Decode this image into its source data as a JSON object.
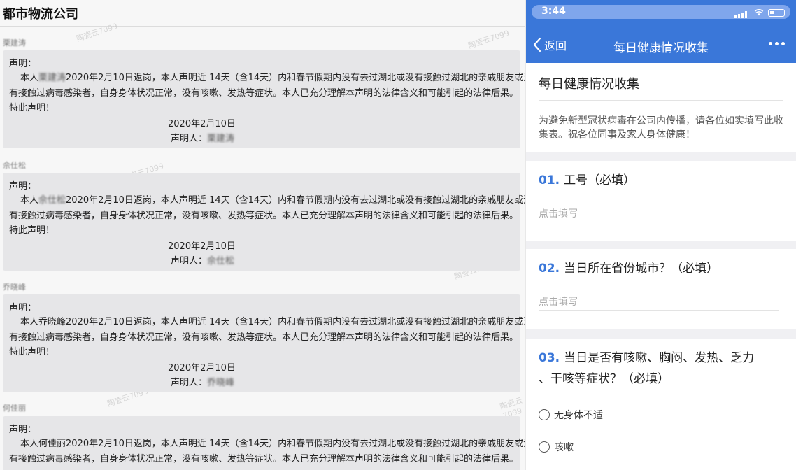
{
  "left": {
    "app_title": "都市物流公司",
    "declarations": [
      {
        "name": "栗建涛",
        "head": "声明：",
        "text_pre": "本人",
        "text_name": "栗建涛",
        "text_after": "2020年2月10日返岗，本人声明近 14天（含14天）内和春节假期内没有去过湖北或没有接触过湖北的亲戚朋友或没",
        "text_line2": "有接触过病毒感染者，自身身体状况正常，没有咳嗽、发热等症状。本人已充分理解本声明的法律含义和可能引起的法律后果。",
        "text_line3": "特此声明！",
        "date": "2020年2月10日",
        "sign_label": "声明人：",
        "sign_name": "栗建涛"
      },
      {
        "name": "佘仕松",
        "head": "声明：",
        "text_pre": "本人",
        "text_name": "佘仕松",
        "text_after": "2020年2月10日返岗，本人声明近 14天（含14天）内和春节假期内没有去过湖北或没有接触过湖北的亲戚朋友或没",
        "text_line2": "有接触过病毒感染者，自身身体状况正常，没有咳嗽、发热等症状。本人已充分理解本声明的法律含义和可能引起的法律后果。",
        "text_line3": "特此声明！",
        "date": "2020年2月10日",
        "sign_label": "声明人：",
        "sign_name": "佘仕松"
      },
      {
        "name": "乔晓峰",
        "head": "声明：",
        "text_pre": "本人",
        "text_name": "乔晓峰",
        "text_after": "2020年2月10日返岗，本人声明近 14天（含14天）内和春节假期内没有去过湖北或没有接触过湖北的亲戚朋友或没",
        "text_line2": "有接触过病毒感染者，自身身体状况正常，没有咳嗽、发热等症状。本人已充分理解本声明的法律含义和可能引起的法律后果。",
        "text_line3": "特此声明！",
        "date": "2020年2月10日",
        "sign_label": "声明人：",
        "sign_name": "乔晓峰"
      },
      {
        "name": "何佳丽",
        "head": "声明：",
        "text_pre": "本人",
        "text_name": "何佳丽",
        "text_after": "2020年2月10日返岗，本人声明近 14天（含14天）内和春节假期内没有去过湖北或没有接触过湖北的亲戚朋友或没",
        "text_line2": "有接触过病毒感染者，自身身体状况正常，没有咳嗽、发热等症状。本人已充分理解本声明的法律含义和可能引起的法律后果。",
        "text_line3": "",
        "date": "",
        "sign_label": "",
        "sign_name": ""
      }
    ],
    "watermark": "陶瓷云7099"
  },
  "right": {
    "status_time": "3:44",
    "nav": {
      "back_label": "返回",
      "title": "每日健康情况收集"
    },
    "form": {
      "title": "每日健康情况收集",
      "description": "为避免新型冠状病毒在公司内传播，请各位如实填写此收集表。祝各位同事及家人身体健康！"
    },
    "questions": [
      {
        "num": "01.",
        "title": "工号（必填）",
        "placeholder": "点击填写"
      },
      {
        "num": "02.",
        "title": "当日所在省份城市？（必填）",
        "placeholder": "点击填写"
      },
      {
        "num": "03.",
        "title_line1": "当日是否有咳嗽、胸闷、发热、乏力",
        "title_line2": "、干咳等症状？（必填）",
        "options": [
          "无身体不适",
          "咳嗽"
        ]
      }
    ],
    "colors": {
      "accent": "#3a77d9"
    }
  }
}
